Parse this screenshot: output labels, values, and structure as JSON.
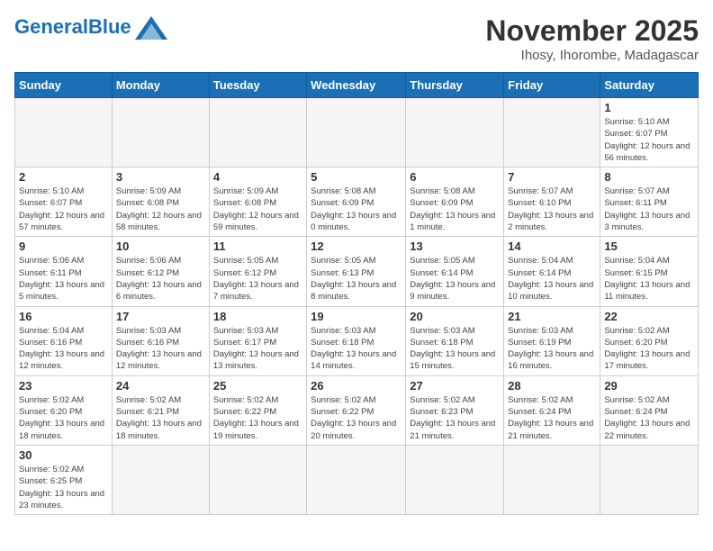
{
  "header": {
    "logo_general": "General",
    "logo_blue": "Blue",
    "month_year": "November 2025",
    "location": "Ihosy, Ihorombe, Madagascar"
  },
  "days_of_week": [
    "Sunday",
    "Monday",
    "Tuesday",
    "Wednesday",
    "Thursday",
    "Friday",
    "Saturday"
  ],
  "weeks": [
    [
      {
        "day": "",
        "info": ""
      },
      {
        "day": "",
        "info": ""
      },
      {
        "day": "",
        "info": ""
      },
      {
        "day": "",
        "info": ""
      },
      {
        "day": "",
        "info": ""
      },
      {
        "day": "",
        "info": ""
      },
      {
        "day": "1",
        "info": "Sunrise: 5:10 AM\nSunset: 6:07 PM\nDaylight: 12 hours and 56 minutes."
      }
    ],
    [
      {
        "day": "2",
        "info": "Sunrise: 5:10 AM\nSunset: 6:07 PM\nDaylight: 12 hours and 57 minutes."
      },
      {
        "day": "3",
        "info": "Sunrise: 5:09 AM\nSunset: 6:08 PM\nDaylight: 12 hours and 58 minutes."
      },
      {
        "day": "4",
        "info": "Sunrise: 5:09 AM\nSunset: 6:08 PM\nDaylight: 12 hours and 59 minutes."
      },
      {
        "day": "5",
        "info": "Sunrise: 5:08 AM\nSunset: 6:09 PM\nDaylight: 13 hours and 0 minutes."
      },
      {
        "day": "6",
        "info": "Sunrise: 5:08 AM\nSunset: 6:09 PM\nDaylight: 13 hours and 1 minute."
      },
      {
        "day": "7",
        "info": "Sunrise: 5:07 AM\nSunset: 6:10 PM\nDaylight: 13 hours and 2 minutes."
      },
      {
        "day": "8",
        "info": "Sunrise: 5:07 AM\nSunset: 6:11 PM\nDaylight: 13 hours and 3 minutes."
      }
    ],
    [
      {
        "day": "9",
        "info": "Sunrise: 5:06 AM\nSunset: 6:11 PM\nDaylight: 13 hours and 5 minutes."
      },
      {
        "day": "10",
        "info": "Sunrise: 5:06 AM\nSunset: 6:12 PM\nDaylight: 13 hours and 6 minutes."
      },
      {
        "day": "11",
        "info": "Sunrise: 5:05 AM\nSunset: 6:12 PM\nDaylight: 13 hours and 7 minutes."
      },
      {
        "day": "12",
        "info": "Sunrise: 5:05 AM\nSunset: 6:13 PM\nDaylight: 13 hours and 8 minutes."
      },
      {
        "day": "13",
        "info": "Sunrise: 5:05 AM\nSunset: 6:14 PM\nDaylight: 13 hours and 9 minutes."
      },
      {
        "day": "14",
        "info": "Sunrise: 5:04 AM\nSunset: 6:14 PM\nDaylight: 13 hours and 10 minutes."
      },
      {
        "day": "15",
        "info": "Sunrise: 5:04 AM\nSunset: 6:15 PM\nDaylight: 13 hours and 11 minutes."
      }
    ],
    [
      {
        "day": "16",
        "info": "Sunrise: 5:04 AM\nSunset: 6:16 PM\nDaylight: 13 hours and 12 minutes."
      },
      {
        "day": "17",
        "info": "Sunrise: 5:03 AM\nSunset: 6:16 PM\nDaylight: 13 hours and 12 minutes."
      },
      {
        "day": "18",
        "info": "Sunrise: 5:03 AM\nSunset: 6:17 PM\nDaylight: 13 hours and 13 minutes."
      },
      {
        "day": "19",
        "info": "Sunrise: 5:03 AM\nSunset: 6:18 PM\nDaylight: 13 hours and 14 minutes."
      },
      {
        "day": "20",
        "info": "Sunrise: 5:03 AM\nSunset: 6:18 PM\nDaylight: 13 hours and 15 minutes."
      },
      {
        "day": "21",
        "info": "Sunrise: 5:03 AM\nSunset: 6:19 PM\nDaylight: 13 hours and 16 minutes."
      },
      {
        "day": "22",
        "info": "Sunrise: 5:02 AM\nSunset: 6:20 PM\nDaylight: 13 hours and 17 minutes."
      }
    ],
    [
      {
        "day": "23",
        "info": "Sunrise: 5:02 AM\nSunset: 6:20 PM\nDaylight: 13 hours and 18 minutes."
      },
      {
        "day": "24",
        "info": "Sunrise: 5:02 AM\nSunset: 6:21 PM\nDaylight: 13 hours and 18 minutes."
      },
      {
        "day": "25",
        "info": "Sunrise: 5:02 AM\nSunset: 6:22 PM\nDaylight: 13 hours and 19 minutes."
      },
      {
        "day": "26",
        "info": "Sunrise: 5:02 AM\nSunset: 6:22 PM\nDaylight: 13 hours and 20 minutes."
      },
      {
        "day": "27",
        "info": "Sunrise: 5:02 AM\nSunset: 6:23 PM\nDaylight: 13 hours and 21 minutes."
      },
      {
        "day": "28",
        "info": "Sunrise: 5:02 AM\nSunset: 6:24 PM\nDaylight: 13 hours and 21 minutes."
      },
      {
        "day": "29",
        "info": "Sunrise: 5:02 AM\nSunset: 6:24 PM\nDaylight: 13 hours and 22 minutes."
      }
    ],
    [
      {
        "day": "30",
        "info": "Sunrise: 5:02 AM\nSunset: 6:25 PM\nDaylight: 13 hours and 23 minutes."
      },
      {
        "day": "",
        "info": ""
      },
      {
        "day": "",
        "info": ""
      },
      {
        "day": "",
        "info": ""
      },
      {
        "day": "",
        "info": ""
      },
      {
        "day": "",
        "info": ""
      },
      {
        "day": "",
        "info": ""
      }
    ]
  ]
}
